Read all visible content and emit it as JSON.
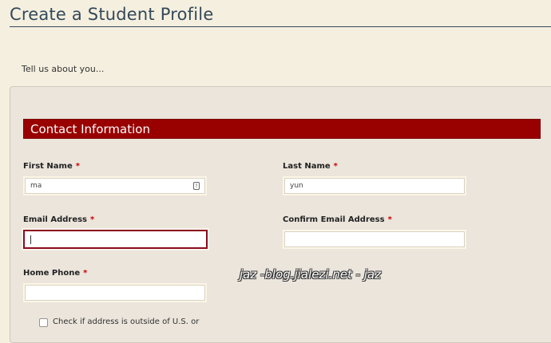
{
  "page": {
    "title": "Create a Student Profile",
    "intro": "Tell us about you..."
  },
  "section": {
    "title": "Contact Information"
  },
  "form": {
    "required_marker": "*",
    "first_name": {
      "label": "First Name",
      "value": "ma"
    },
    "last_name": {
      "label": "Last Name",
      "value": "yun"
    },
    "email": {
      "label": "Email Address",
      "value": ""
    },
    "confirm_email": {
      "label": "Confirm Email Address",
      "value": ""
    },
    "home_phone": {
      "label": "Home Phone",
      "value": ""
    },
    "outside_us": {
      "label": "Check if address is outside of U.S. or",
      "checked": false
    }
  },
  "watermark": "jaz -blog.jialezi.net - jaz",
  "colors": {
    "background": "#f5efdf",
    "panel": "#ebe5dc",
    "section_bar": "#990000",
    "title": "#33495a",
    "required": "#cc0000",
    "focus_border": "#8b0a1e"
  },
  "icons": {
    "first_name_field_icon": "key-icon"
  }
}
